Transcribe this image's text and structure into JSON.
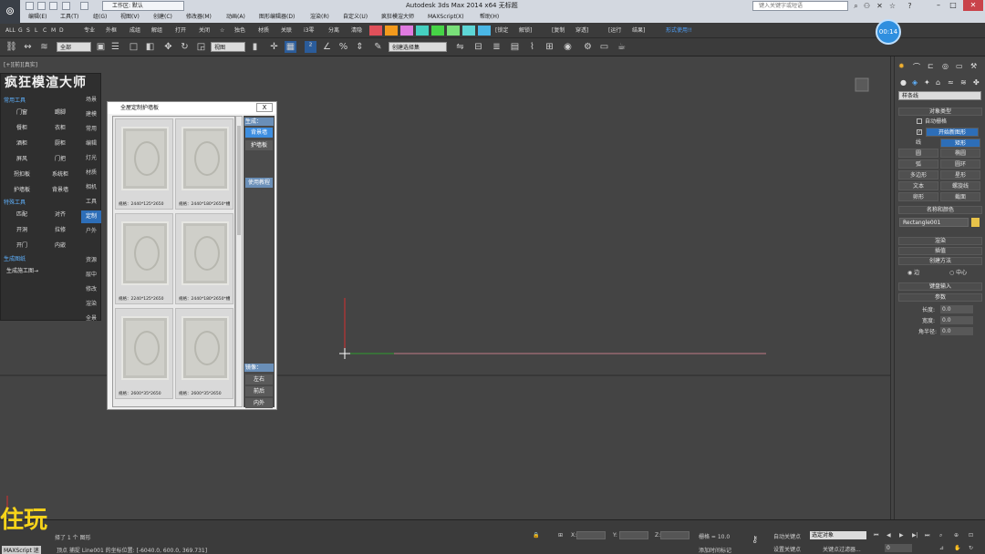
{
  "titlebar": {
    "workspace": "工作区: 默认",
    "title": "Autodesk 3ds Max  2014 x64        无标题",
    "search_placeholder": "键入关键字或短语"
  },
  "menu": [
    "编辑(E)",
    "工具(T)",
    "组(G)",
    "视图(V)",
    "创建(C)",
    "修改器(M)",
    "动画(A)",
    "图形编辑器(D)",
    "渲染(R)",
    "自定义(U)",
    "疯狂模渲大师",
    "MAXScript(X)",
    "帮助(H)"
  ],
  "ribbon": {
    "labels_left": [
      "ALL",
      "G",
      "S",
      "L",
      "C",
      "M",
      "D"
    ],
    "labels_mid": [
      "专业",
      "外框",
      "成组",
      "解组",
      "打开",
      "关闭",
      "☆",
      "独色",
      "材质",
      "关联",
      "i3零",
      "分离",
      "清隐"
    ],
    "swatch_colors": [
      "#e0505a",
      "#f39a1c",
      "#e07ae0",
      "#45d0c0",
      "#46d446",
      "#79e079",
      "#5dd6d6",
      "#4ab7e6"
    ],
    "labels_right": [
      "[锁定",
      "解锁]",
      "[复制",
      "穿透]",
      "[运行",
      "结果]"
    ],
    "link": "形式使用!!",
    "timer": "00:14"
  },
  "toolbar": {
    "filter": "全部",
    "view": "视图",
    "selection_set": "创建选择集"
  },
  "viewport": {
    "label": "[+][前][真实]"
  },
  "plugin": {
    "title": "疯狂模渲大师",
    "common_tools_label": "常用工具",
    "buttons": [
      [
        "门窗",
        "踢脚"
      ],
      [
        "餐柜",
        "衣柜"
      ],
      [
        "酒柜",
        "厨柜"
      ],
      [
        "屏风",
        "门把"
      ],
      [
        "拐扣板",
        "系统柜"
      ],
      [
        "护墙板",
        "背景墙"
      ]
    ],
    "special_tools_label": "特殊工具",
    "special_buttons": [
      [
        "匹配",
        "对齐"
      ],
      [
        "开洞",
        "拉修"
      ],
      [
        "开门",
        "内嵌"
      ]
    ],
    "gen_label": "生成图纸",
    "gen_button": "生成施工图→",
    "side_tabs": [
      "场景",
      "建模",
      "常用",
      "编辑",
      "灯光",
      "材质",
      "相机",
      "工具",
      "定制",
      "户外",
      "",
      "资源",
      "层中",
      "修改",
      "渲染",
      "全景"
    ]
  },
  "dialog": {
    "title": "全屋定制护墙板",
    "close": "X",
    "thumbs": [
      "规格：2440*125*2650",
      "规格：2440*180*2650*槽",
      "规格：2240*125*2650",
      "规格：2440*180*2650*槽",
      "规格：2600*35*2650",
      "规格：2600*35*2650"
    ],
    "generate_label": "生成：",
    "btn_bgwall": "背景墙",
    "btn_hqb": "护墙板",
    "btn_tutorial": "使用教程",
    "mirror_label": "镜像：",
    "btn_lr": "左右",
    "btn_fb": "前后",
    "btn_io": "内外"
  },
  "cmdpanel": {
    "dropdown": "样条线",
    "object_type": "对象类型",
    "auto_grid": "自动栅格",
    "start_new_shape": "开始新图形",
    "shapes": [
      [
        "线",
        "矩形"
      ],
      [
        "圆",
        "椭圆"
      ],
      [
        "弧",
        "圆环"
      ],
      [
        "多边形",
        "星形"
      ],
      [
        "文本",
        "螺旋线"
      ],
      [
        "卵形",
        "截面"
      ]
    ],
    "name_color": "名称和颜色",
    "object_name": "Rectangle001",
    "object_color": "#e8c34a",
    "rollouts": [
      "渲染",
      "插值",
      "创建方法"
    ],
    "method_edge": "边",
    "method_center": "中心",
    "keyboard_entry": "键盘输入",
    "params": "参数",
    "length_label": "长度:",
    "length_val": "0.0",
    "width_label": "宽度:",
    "width_val": "0.0",
    "corner_label": "角半径:",
    "corner_val": "0.0"
  },
  "status": {
    "selected": "择了 1 个 图形",
    "prompt": "顶点 捕捉 Line001 的坐标位置: [-6040.0, 600.0, 369.731]",
    "x_label": "X:",
    "y_label": "Y:",
    "z_label": "Z:",
    "grid": "栅格 = 10.0",
    "add_time_tag": "添加时间标记",
    "auto_key": "自动关键点",
    "key_mode": "选定对象",
    "set_key": "设置关键点",
    "key_filter": "关键点过滤器...",
    "frame": "0",
    "maxscript": "MAXScript 迷",
    "overlay": "住玩"
  }
}
